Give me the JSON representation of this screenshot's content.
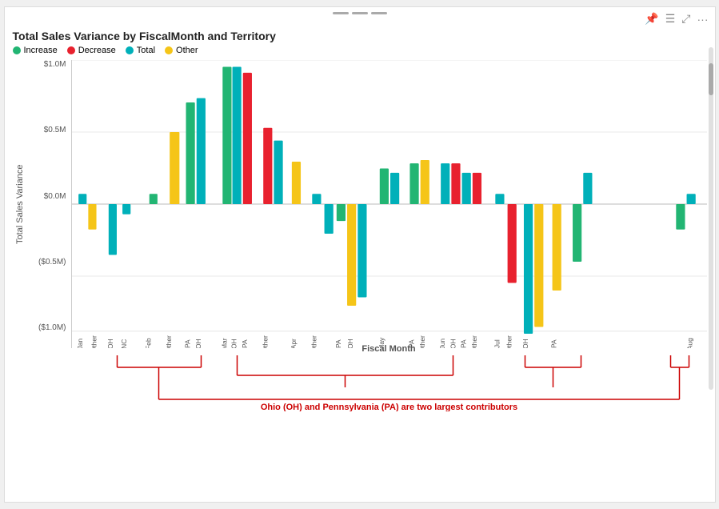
{
  "card": {
    "title": "Total Sales Variance by FiscalMonth and Territory",
    "y_axis_label": "Total Sales Variance",
    "x_axis_label": "Fiscal Month",
    "annotation": "Ohio (OH) and Pennsylvania (PA) are two largest contributors"
  },
  "legend": [
    {
      "label": "Increase",
      "color": "#22b573"
    },
    {
      "label": "Decrease",
      "color": "#e8212e"
    },
    {
      "label": "Total",
      "color": "#00b0b9"
    },
    {
      "label": "Other",
      "color": "#f5c518"
    }
  ],
  "y_labels": [
    "$1.0M",
    "$0.5M",
    "$0.0M",
    "($0.5M)",
    "($1.0M)"
  ],
  "x_labels": [
    "Jan",
    "Other",
    "OH",
    "NC",
    "Feb",
    "Other",
    "PA",
    "OH",
    "Mar",
    "OH",
    "PA",
    "Other",
    "Apr",
    "Other",
    "PA",
    "OH",
    "May",
    "PA",
    "Other",
    "Jun",
    "OH",
    "PA",
    "Other",
    "Jul",
    "Other",
    "OH",
    "PA",
    "Aug"
  ],
  "colors": {
    "increase": "#22b573",
    "decrease": "#e8212e",
    "total": "#00b0b9",
    "other": "#f5c518",
    "grid": "#e8e8e8",
    "zero": "#bbb",
    "annotation": "#c00"
  },
  "icons": {
    "pin": "📌",
    "menu": "☰",
    "expand": "⤢",
    "more": "···",
    "drag": "⠿"
  }
}
